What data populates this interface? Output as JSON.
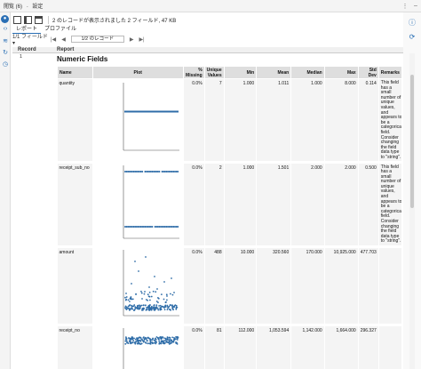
{
  "window": {
    "title": "閲覧 (6)",
    "title_sep": "-",
    "title_right": "設定"
  },
  "toolbar": {
    "status": "2 のレコードが表示されました 2 フィールド, 47 KB"
  },
  "tabs": [
    {
      "label": "レポート",
      "active": true
    },
    {
      "label": "プロファイル",
      "active": false
    }
  ],
  "nav": {
    "field_select": "1/1 フィールド",
    "record_box": "1/2 のレコード"
  },
  "grid": {
    "col_record": "Record",
    "col_report": "Report",
    "record_number": "1"
  },
  "report": {
    "title": "Numeric Fields",
    "headers": {
      "name": "Name",
      "plot": "Plot",
      "missing": "% Missing",
      "unique": "Unique Values",
      "min": "Min",
      "mean": "Mean",
      "median": "Median",
      "max": "Max",
      "stddev": "Std Dev",
      "remarks": "Remarks"
    },
    "rows": [
      {
        "name": "quantity",
        "missing": "0.0%",
        "unique": "7",
        "min": "1.000",
        "mean": "1.011",
        "median": "1.000",
        "max": "8.000",
        "stddev": "0.114",
        "remarks": "This field has a small number of unique values, and appears to be a categorical field. Consider changing the field data type to \"string\"."
      },
      {
        "name": "receipt_sub_no",
        "missing": "0.0%",
        "unique": "2",
        "min": "1.000",
        "mean": "1.501",
        "median": "2.000",
        "max": "2.000",
        "stddev": "0.500",
        "remarks": "This field has a small number of unique values, and appears to be a categorical field. Consider changing the field data type to \"string\"."
      },
      {
        "name": "amount",
        "missing": "0.0%",
        "unique": "488",
        "min": "10.000",
        "mean": "320.560",
        "median": "170.000",
        "max": "10,925.000",
        "stddev": "477.703",
        "remarks": ""
      },
      {
        "name": "receipt_no",
        "missing": "0.0%",
        "unique": "81",
        "min": "112.000",
        "mean": "1,053.594",
        "median": "1,142.000",
        "max": "1,664.000",
        "stddev": "296.327",
        "remarks": ""
      }
    ]
  },
  "plot_colors": {
    "points": "#2f6da8",
    "axis": "#555555"
  },
  "icons": {
    "left": [
      "circle-icon",
      "code-icon",
      "layers-icon",
      "refresh-icon",
      "history-icon"
    ],
    "right": [
      "info-icon",
      "sync-icon"
    ]
  }
}
